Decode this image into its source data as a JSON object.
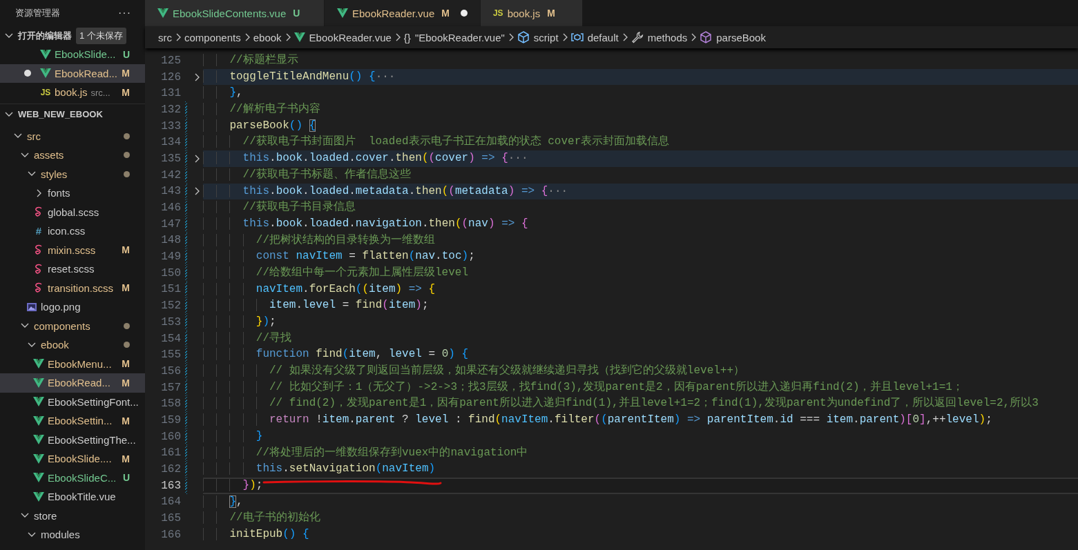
{
  "sidebar": {
    "title": "资源管理器",
    "more": "···",
    "open_editors": {
      "label": "打开的编辑器",
      "badge": "1 个未保存",
      "expanded": true,
      "items": [
        {
          "kind": "vue",
          "name": "EbookSlide...",
          "status": "U",
          "unsaved": false,
          "selected": false
        },
        {
          "kind": "vue",
          "name": "EbookRead...",
          "status": "M",
          "unsaved": true,
          "selected": true
        },
        {
          "kind": "js",
          "icon_label": "JS",
          "name": "book.js",
          "detail": "src...",
          "status": "M",
          "unsaved": false,
          "selected": false
        }
      ]
    },
    "project": {
      "label": "WEB_NEW_EBOOK",
      "expanded": true,
      "tree": [
        {
          "kind": "folder",
          "name": "src",
          "expanded": true,
          "has_changes": true,
          "selected": false,
          "children": [
            {
              "kind": "folder",
              "name": "assets",
              "expanded": true,
              "has_changes": true,
              "selected": false,
              "children": [
                {
                  "kind": "folder",
                  "name": "styles",
                  "expanded": true,
                  "has_changes": true,
                  "selected": false,
                  "children": [
                    {
                      "kind": "folder",
                      "name": "fonts",
                      "expanded": false,
                      "has_changes": false,
                      "selected": false
                    },
                    {
                      "kind": "scss",
                      "name": "global.scss",
                      "selected": false
                    },
                    {
                      "kind": "css",
                      "icon_label": "#",
                      "name": "icon.css",
                      "selected": false
                    },
                    {
                      "kind": "scss",
                      "name": "mixin.scss",
                      "status": "M",
                      "selected": false
                    },
                    {
                      "kind": "scss",
                      "name": "reset.scss",
                      "selected": false
                    },
                    {
                      "kind": "scss",
                      "name": "transition.scss",
                      "status": "M",
                      "selected": false
                    }
                  ]
                },
                {
                  "kind": "image",
                  "name": "logo.png",
                  "selected": false
                }
              ]
            },
            {
              "kind": "folder",
              "name": "components",
              "expanded": true,
              "has_changes": true,
              "selected": false,
              "children": [
                {
                  "kind": "folder",
                  "name": "ebook",
                  "expanded": true,
                  "has_changes": true,
                  "selected": false,
                  "children": [
                    {
                      "kind": "vue",
                      "name": "EbookMenu...",
                      "status": "M",
                      "selected": false
                    },
                    {
                      "kind": "vue",
                      "name": "EbookRead...",
                      "status": "M",
                      "selected": true
                    },
                    {
                      "kind": "vue",
                      "name": "EbookSettingFont...",
                      "selected": false
                    },
                    {
                      "kind": "vue",
                      "name": "EbookSettin...",
                      "status": "M",
                      "selected": false
                    },
                    {
                      "kind": "vue",
                      "name": "EbookSettingThe...",
                      "selected": false
                    },
                    {
                      "kind": "vue",
                      "name": "EbookSlide....",
                      "status": "M",
                      "selected": false
                    },
                    {
                      "kind": "vue",
                      "name": "EbookSlideC...",
                      "status": "U",
                      "selected": false
                    },
                    {
                      "kind": "vue",
                      "name": "EbookTitle.vue",
                      "selected": false
                    }
                  ]
                }
              ]
            },
            {
              "kind": "folder",
              "name": "store",
              "expanded": true,
              "has_changes": false,
              "selected": false,
              "children": [
                {
                  "kind": "folder",
                  "name": "modules",
                  "expanded": true,
                  "has_changes": false,
                  "selected": false
                }
              ]
            }
          ]
        }
      ]
    }
  },
  "tabs": [
    {
      "kind": "vue",
      "label": "EbookSlideContents.vue",
      "status": "U",
      "dirty": false,
      "selected": false
    },
    {
      "kind": "vue",
      "label": "EbookReader.vue",
      "status": "M",
      "dirty": true,
      "selected": true
    },
    {
      "kind": "js",
      "icon_label": "JS",
      "label": "book.js",
      "status": "M",
      "dirty": false,
      "selected": false
    }
  ],
  "breadcrumbs": [
    {
      "kind": "folder",
      "label": "src"
    },
    {
      "kind": "folder",
      "label": "components"
    },
    {
      "kind": "folder",
      "label": "ebook"
    },
    {
      "kind": "vue",
      "label": "EbookReader.vue"
    },
    {
      "kind": "object",
      "icon_label": "{}",
      "label": "\"EbookReader.vue\""
    },
    {
      "kind": "module",
      "label": "script"
    },
    {
      "kind": "variable",
      "label": "default"
    },
    {
      "kind": "method",
      "label": "methods"
    },
    {
      "kind": "function",
      "label": "parseBook"
    }
  ],
  "editor": {
    "lines": [
      {
        "number": "125",
        "changed": false,
        "folded": false,
        "highlighted": false,
        "current": false,
        "underlined": false,
        "tokens": [
          {
            "kind": "comment",
            "text": "    //标题栏显示"
          }
        ]
      },
      {
        "number": "126",
        "changed": false,
        "folded": true,
        "highlighted": true,
        "current": false,
        "underlined": false,
        "tokens": [
          {
            "kind": "fn",
            "text": "    toggleTitleAndMenu"
          },
          {
            "kind": "b3",
            "text": "() {"
          },
          {
            "kind": "fold",
            "text": "···"
          }
        ]
      },
      {
        "number": "131",
        "changed": false,
        "folded": false,
        "highlighted": false,
        "current": false,
        "underlined": false,
        "tokens": [
          {
            "kind": "b3",
            "text": "    }"
          },
          {
            "kind": "plain",
            "text": ","
          }
        ]
      },
      {
        "number": "132",
        "changed": true,
        "folded": false,
        "highlighted": false,
        "current": false,
        "underlined": false,
        "tokens": [
          {
            "kind": "comment",
            "text": "    //解析电子书内容"
          }
        ]
      },
      {
        "number": "133",
        "changed": true,
        "folded": false,
        "highlighted": false,
        "current": false,
        "underlined": false,
        "tokens": [
          {
            "kind": "fn",
            "text": "    parseBook"
          },
          {
            "kind": "b3",
            "text": "() "
          },
          {
            "kind": "b3m",
            "text": "{"
          }
        ]
      },
      {
        "number": "134",
        "changed": true,
        "folded": false,
        "highlighted": false,
        "current": false,
        "underlined": false,
        "tokens": [
          {
            "kind": "comment",
            "text": "      //获取电子书封面图片  loaded表示电子书正在加载的状态 cover表示封面加载信息"
          }
        ]
      },
      {
        "number": "135",
        "changed": true,
        "folded": true,
        "highlighted": true,
        "current": false,
        "underlined": false,
        "tokens": [
          {
            "kind": "kw",
            "text": "      this"
          },
          {
            "kind": "plain",
            "text": "."
          },
          {
            "kind": "var",
            "text": "book"
          },
          {
            "kind": "plain",
            "text": "."
          },
          {
            "kind": "var",
            "text": "loaded"
          },
          {
            "kind": "plain",
            "text": "."
          },
          {
            "kind": "var",
            "text": "cover"
          },
          {
            "kind": "plain",
            "text": "."
          },
          {
            "kind": "fn",
            "text": "then"
          },
          {
            "kind": "b1",
            "text": "("
          },
          {
            "kind": "b2",
            "text": "("
          },
          {
            "kind": "var",
            "text": "cover"
          },
          {
            "kind": "b2",
            "text": ")"
          },
          {
            "kind": "kw",
            "text": " => "
          },
          {
            "kind": "b2",
            "text": "{"
          },
          {
            "kind": "fold",
            "text": "···"
          }
        ]
      },
      {
        "number": "142",
        "changed": true,
        "folded": false,
        "highlighted": false,
        "current": false,
        "underlined": false,
        "tokens": [
          {
            "kind": "comment",
            "text": "      //获取电子书标题、作者信息这些"
          }
        ]
      },
      {
        "number": "143",
        "changed": true,
        "folded": true,
        "highlighted": true,
        "current": false,
        "underlined": false,
        "tokens": [
          {
            "kind": "kw",
            "text": "      this"
          },
          {
            "kind": "plain",
            "text": "."
          },
          {
            "kind": "var",
            "text": "book"
          },
          {
            "kind": "plain",
            "text": "."
          },
          {
            "kind": "var",
            "text": "loaded"
          },
          {
            "kind": "plain",
            "text": "."
          },
          {
            "kind": "var",
            "text": "metadata"
          },
          {
            "kind": "plain",
            "text": "."
          },
          {
            "kind": "fn",
            "text": "then"
          },
          {
            "kind": "b1",
            "text": "("
          },
          {
            "kind": "b2",
            "text": "("
          },
          {
            "kind": "var",
            "text": "metadata"
          },
          {
            "kind": "b2",
            "text": ")"
          },
          {
            "kind": "kw",
            "text": " => "
          },
          {
            "kind": "b2",
            "text": "{"
          },
          {
            "kind": "fold",
            "text": "···"
          }
        ]
      },
      {
        "number": "146",
        "changed": true,
        "folded": false,
        "highlighted": false,
        "current": false,
        "underlined": false,
        "tokens": [
          {
            "kind": "comment",
            "text": "      //获取电子书目录信息"
          }
        ]
      },
      {
        "number": "147",
        "changed": true,
        "folded": false,
        "highlighted": false,
        "current": false,
        "underlined": false,
        "tokens": [
          {
            "kind": "kw",
            "text": "      this"
          },
          {
            "kind": "plain",
            "text": "."
          },
          {
            "kind": "var",
            "text": "book"
          },
          {
            "kind": "plain",
            "text": "."
          },
          {
            "kind": "var",
            "text": "loaded"
          },
          {
            "kind": "plain",
            "text": "."
          },
          {
            "kind": "var",
            "text": "navigation"
          },
          {
            "kind": "plain",
            "text": "."
          },
          {
            "kind": "fn",
            "text": "then"
          },
          {
            "kind": "b1",
            "text": "("
          },
          {
            "kind": "b2",
            "text": "("
          },
          {
            "kind": "var",
            "text": "nav"
          },
          {
            "kind": "b2",
            "text": ")"
          },
          {
            "kind": "kw",
            "text": " => "
          },
          {
            "kind": "b2",
            "text": "{"
          }
        ]
      },
      {
        "number": "148",
        "changed": true,
        "folded": false,
        "highlighted": false,
        "current": false,
        "underlined": false,
        "tokens": [
          {
            "kind": "comment",
            "text": "        //把树状结构的目录转换为一维数组"
          }
        ]
      },
      {
        "number": "149",
        "changed": true,
        "folded": false,
        "highlighted": false,
        "current": false,
        "underlined": false,
        "tokens": [
          {
            "kind": "kw",
            "text": "        const"
          },
          {
            "kind": "const",
            "text": " navItem"
          },
          {
            "kind": "plain",
            "text": " = "
          },
          {
            "kind": "fn",
            "text": "flatten"
          },
          {
            "kind": "b3",
            "text": "("
          },
          {
            "kind": "var",
            "text": "nav"
          },
          {
            "kind": "plain",
            "text": "."
          },
          {
            "kind": "var",
            "text": "toc"
          },
          {
            "kind": "b3",
            "text": ")"
          },
          {
            "kind": "plain",
            "text": ";"
          }
        ]
      },
      {
        "number": "150",
        "changed": true,
        "folded": false,
        "highlighted": false,
        "current": false,
        "underlined": false,
        "tokens": [
          {
            "kind": "comment",
            "text": "        //给数组中每一个元素加上属性层级level"
          }
        ]
      },
      {
        "number": "151",
        "changed": true,
        "folded": false,
        "highlighted": false,
        "current": false,
        "underlined": false,
        "tokens": [
          {
            "kind": "const",
            "text": "        navItem"
          },
          {
            "kind": "plain",
            "text": "."
          },
          {
            "kind": "fn",
            "text": "forEach"
          },
          {
            "kind": "b3",
            "text": "("
          },
          {
            "kind": "b1",
            "text": "("
          },
          {
            "kind": "var",
            "text": "item"
          },
          {
            "kind": "b1",
            "text": ")"
          },
          {
            "kind": "kw",
            "text": " => "
          },
          {
            "kind": "b1",
            "text": "{"
          }
        ]
      },
      {
        "number": "152",
        "changed": true,
        "folded": false,
        "highlighted": false,
        "current": false,
        "underlined": false,
        "tokens": [
          {
            "kind": "var",
            "text": "          item"
          },
          {
            "kind": "plain",
            "text": "."
          },
          {
            "kind": "var",
            "text": "level"
          },
          {
            "kind": "plain",
            "text": " = "
          },
          {
            "kind": "fn",
            "text": "find"
          },
          {
            "kind": "b2",
            "text": "("
          },
          {
            "kind": "var",
            "text": "item"
          },
          {
            "kind": "b2",
            "text": ")"
          },
          {
            "kind": "plain",
            "text": ";"
          }
        ]
      },
      {
        "number": "153",
        "changed": true,
        "folded": false,
        "highlighted": false,
        "current": false,
        "underlined": false,
        "tokens": [
          {
            "kind": "b1",
            "text": "        }"
          },
          {
            "kind": "b3",
            "text": ")"
          },
          {
            "kind": "plain",
            "text": ";"
          }
        ]
      },
      {
        "number": "154",
        "changed": true,
        "folded": false,
        "highlighted": false,
        "current": false,
        "underlined": false,
        "tokens": [
          {
            "kind": "comment",
            "text": "        //寻找"
          }
        ]
      },
      {
        "number": "155",
        "changed": true,
        "folded": false,
        "highlighted": false,
        "current": false,
        "underlined": false,
        "tokens": [
          {
            "kind": "kw",
            "text": "        function"
          },
          {
            "kind": "fn",
            "text": " find"
          },
          {
            "kind": "b3",
            "text": "("
          },
          {
            "kind": "var",
            "text": "item"
          },
          {
            "kind": "plain",
            "text": ", "
          },
          {
            "kind": "var",
            "text": "level"
          },
          {
            "kind": "plain",
            "text": " = "
          },
          {
            "kind": "num",
            "text": "0"
          },
          {
            "kind": "b3",
            "text": ")"
          },
          {
            "kind": "b3",
            "text": " {"
          }
        ]
      },
      {
        "number": "156",
        "changed": true,
        "folded": false,
        "highlighted": false,
        "current": false,
        "underlined": false,
        "tokens": [
          {
            "kind": "comment",
            "text": "          // 如果没有父级了则返回当前层级，如果还有父级就继续递归寻找（找到它的父级就level++）"
          }
        ]
      },
      {
        "number": "157",
        "changed": true,
        "folded": false,
        "highlighted": false,
        "current": false,
        "underlined": false,
        "tokens": [
          {
            "kind": "comment",
            "text": "          // 比如父到子：1（无父了）->2->3；找3层级，找find(3),发现parent是2，因有parent所以进入递归再find(2)，并且level+1=1；"
          }
        ]
      },
      {
        "number": "158",
        "changed": true,
        "folded": false,
        "highlighted": false,
        "current": false,
        "underlined": false,
        "tokens": [
          {
            "kind": "comment",
            "text": "          // find(2)，发现parent是1，因有parent所以进入递归find(1),并且level+1=2；find(1),发现parent为undefind了，所以返回level=2,所以3"
          }
        ]
      },
      {
        "number": "159",
        "changed": true,
        "folded": false,
        "highlighted": false,
        "current": false,
        "underlined": false,
        "tokens": [
          {
            "kind": "ctl",
            "text": "          return"
          },
          {
            "kind": "plain",
            "text": " !"
          },
          {
            "kind": "var",
            "text": "item"
          },
          {
            "kind": "plain",
            "text": "."
          },
          {
            "kind": "var",
            "text": "parent"
          },
          {
            "kind": "plain",
            "text": " ? "
          },
          {
            "kind": "var",
            "text": "level"
          },
          {
            "kind": "plain",
            "text": " : "
          },
          {
            "kind": "fn",
            "text": "find"
          },
          {
            "kind": "b1",
            "text": "("
          },
          {
            "kind": "const",
            "text": "navItem"
          },
          {
            "kind": "plain",
            "text": "."
          },
          {
            "kind": "fn",
            "text": "filter"
          },
          {
            "kind": "b2",
            "text": "("
          },
          {
            "kind": "b3",
            "text": "("
          },
          {
            "kind": "var",
            "text": "parentItem"
          },
          {
            "kind": "b3",
            "text": ")"
          },
          {
            "kind": "kw",
            "text": " => "
          },
          {
            "kind": "var",
            "text": "parentItem"
          },
          {
            "kind": "plain",
            "text": "."
          },
          {
            "kind": "var",
            "text": "id"
          },
          {
            "kind": "plain",
            "text": " === "
          },
          {
            "kind": "var",
            "text": "item"
          },
          {
            "kind": "plain",
            "text": "."
          },
          {
            "kind": "var",
            "text": "parent"
          },
          {
            "kind": "b2",
            "text": ")["
          },
          {
            "kind": "num",
            "text": "0"
          },
          {
            "kind": "b2",
            "text": "]"
          },
          {
            "kind": "plain",
            "text": ",++"
          },
          {
            "kind": "var",
            "text": "level"
          },
          {
            "kind": "b1",
            "text": ")"
          },
          {
            "kind": "plain",
            "text": ";"
          }
        ]
      },
      {
        "number": "160",
        "changed": true,
        "folded": false,
        "highlighted": false,
        "current": false,
        "underlined": false,
        "tokens": [
          {
            "kind": "b3",
            "text": "        }"
          }
        ]
      },
      {
        "number": "161",
        "changed": true,
        "folded": false,
        "highlighted": false,
        "current": false,
        "underlined": false,
        "tokens": [
          {
            "kind": "comment",
            "text": "        //将处理后的一维数组保存到vuex中的navigation中"
          }
        ]
      },
      {
        "number": "162",
        "changed": true,
        "folded": false,
        "highlighted": false,
        "current": false,
        "underlined": false,
        "tokens": [
          {
            "kind": "kw",
            "text": "        this"
          },
          {
            "kind": "plain",
            "text": "."
          },
          {
            "kind": "fn",
            "text": "setNavigation"
          },
          {
            "kind": "b3",
            "text": "("
          },
          {
            "kind": "const",
            "text": "navItem"
          },
          {
            "kind": "b3",
            "text": ")"
          }
        ]
      },
      {
        "number": "163",
        "changed": true,
        "folded": false,
        "highlighted": false,
        "current": true,
        "underlined": true,
        "tokens": [
          {
            "kind": "b2",
            "text": "      }"
          },
          {
            "kind": "b1",
            "text": ")"
          },
          {
            "kind": "plain",
            "text": ";"
          }
        ]
      },
      {
        "number": "164",
        "changed": false,
        "folded": false,
        "highlighted": false,
        "current": false,
        "underlined": false,
        "tokens": [
          {
            "kind": "b3m",
            "text": "    }"
          },
          {
            "kind": "plain",
            "text": ","
          }
        ]
      },
      {
        "number": "165",
        "changed": false,
        "folded": false,
        "highlighted": false,
        "current": false,
        "underlined": false,
        "tokens": [
          {
            "kind": "comment",
            "text": "    //电子书的初始化"
          }
        ]
      },
      {
        "number": "166",
        "changed": false,
        "folded": false,
        "highlighted": false,
        "current": false,
        "underlined": false,
        "tokens": [
          {
            "kind": "fn",
            "text": "    initEpub"
          },
          {
            "kind": "b3",
            "text": "() {"
          }
        ]
      }
    ]
  }
}
